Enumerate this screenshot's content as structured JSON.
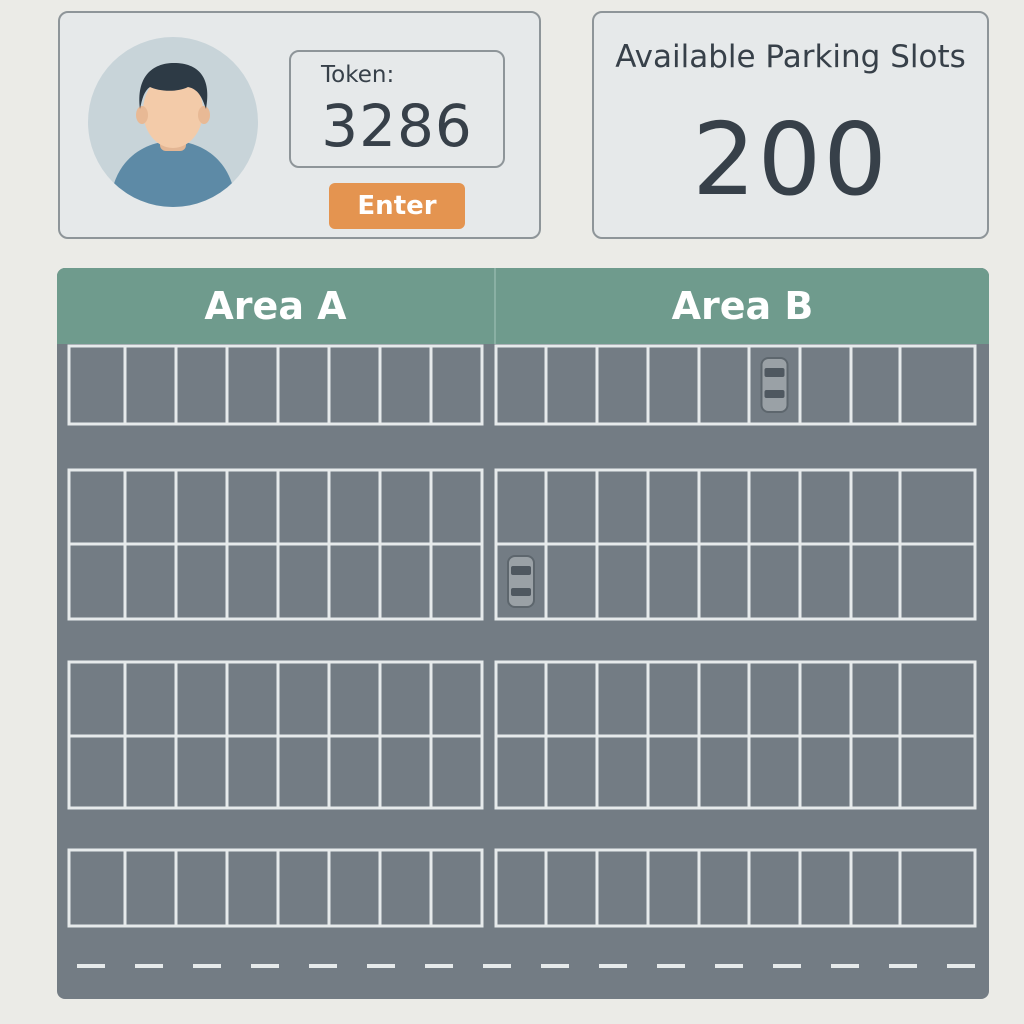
{
  "user": {
    "token_label": "Token:",
    "token_value": "3286",
    "enter_label": "Enter"
  },
  "slots": {
    "title": "Available Parking Slots",
    "count": "200"
  },
  "lot": {
    "areas": [
      {
        "name": "Area A"
      },
      {
        "name": "Area B"
      }
    ],
    "occupied_slots": [
      {
        "row": 1,
        "area": "Area B",
        "slot": 6
      },
      {
        "row": 3,
        "area": "Area B",
        "slot": 1
      }
    ]
  },
  "colors": {
    "accent": "#e49450",
    "header": "#6f9b8d",
    "asphalt": "#737c84",
    "text": "#374049"
  }
}
